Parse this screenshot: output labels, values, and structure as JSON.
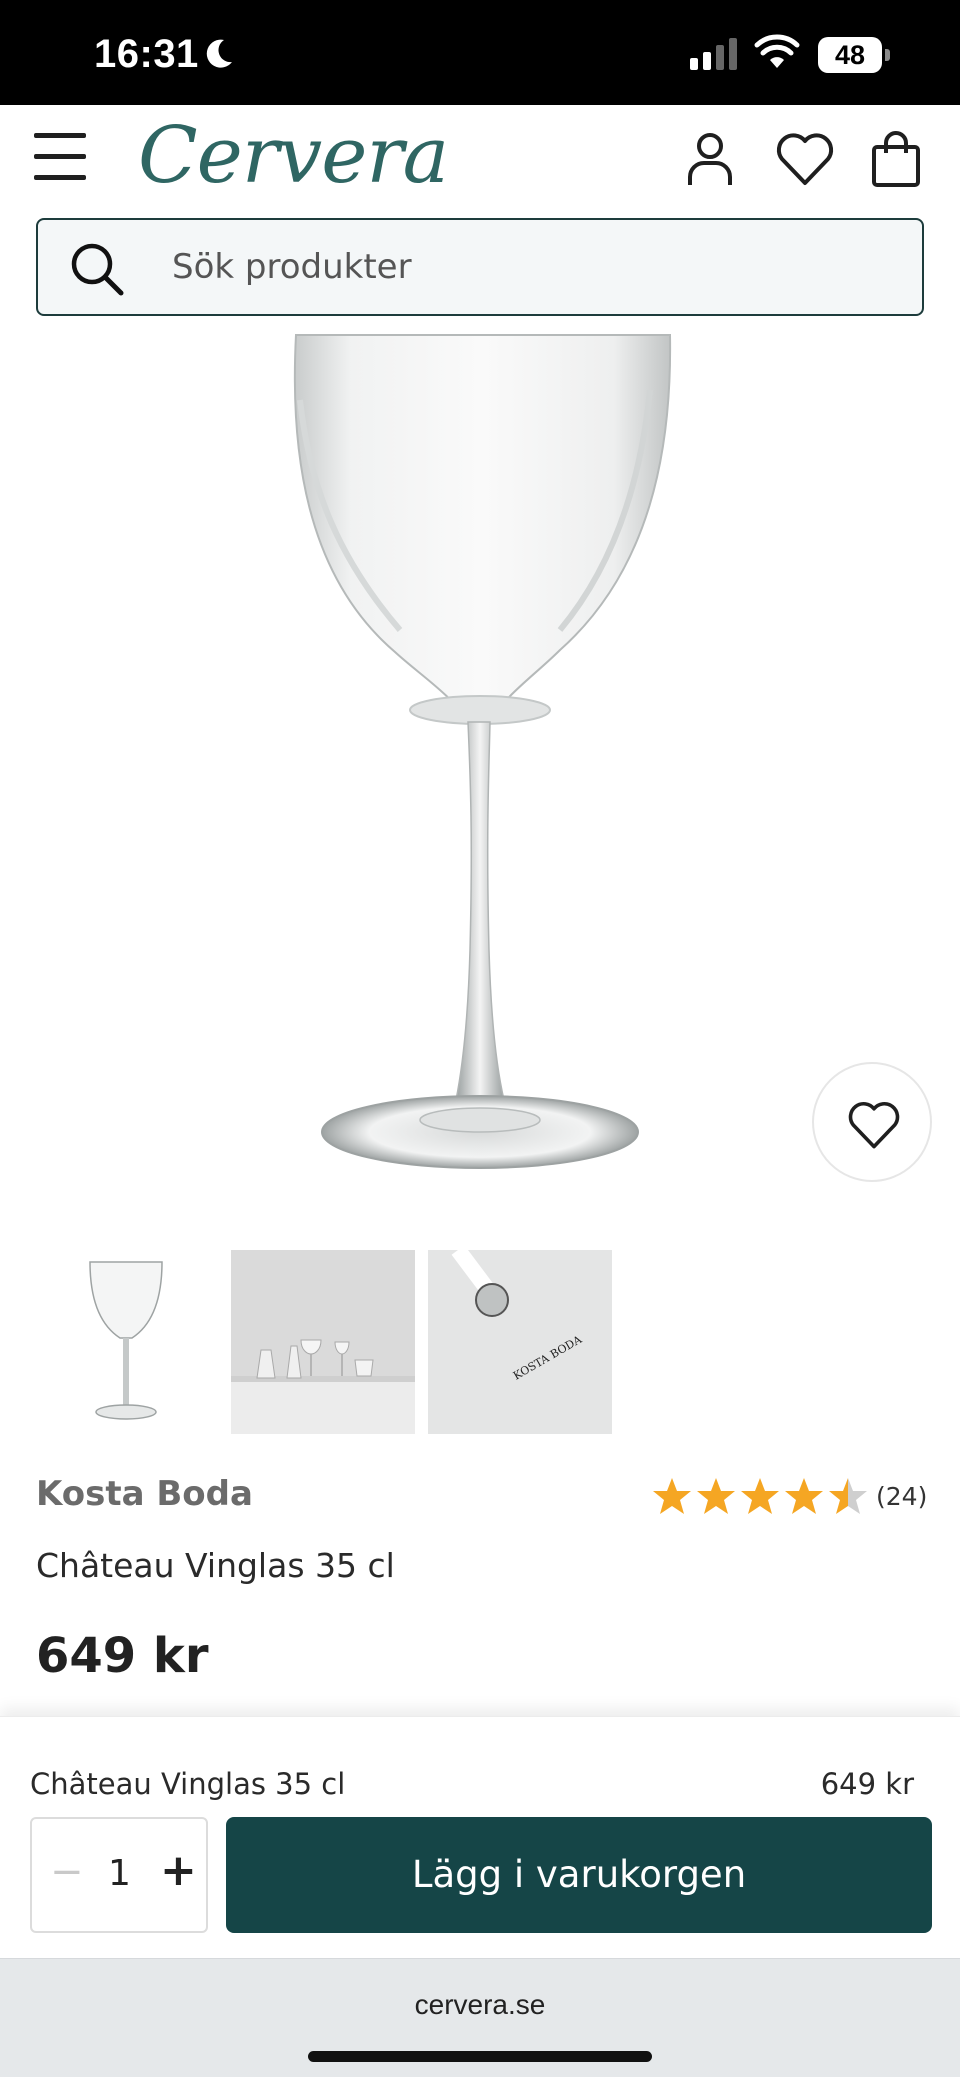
{
  "status_bar": {
    "time": "16:31",
    "battery": "48"
  },
  "header": {
    "logo": "Cervera"
  },
  "search": {
    "placeholder": "Sök produkter"
  },
  "product": {
    "brand": "Kosta Boda",
    "name": "Château Vinglas 35 cl",
    "price": "649 kr",
    "rating": 4.5,
    "rating_max": 5,
    "review_count": "(24)",
    "thumb_stamp": "KOSTA BODA"
  },
  "cart_bar": {
    "name": "Château Vinglas 35 cl",
    "price": "649 kr",
    "qty_minus": "−",
    "qty_value": "1",
    "qty_plus": "+",
    "add_label": "Lägg i varukorgen"
  },
  "browser": {
    "url": "cervera.se"
  },
  "colors": {
    "brand": "#2f6663",
    "button": "#154547",
    "star": "#f5a623"
  },
  "icons": [
    "moon-icon",
    "signal-icon",
    "wifi-icon",
    "battery-icon",
    "menu-icon",
    "user-icon",
    "heart-icon",
    "bag-icon",
    "search-icon",
    "star-icon"
  ]
}
